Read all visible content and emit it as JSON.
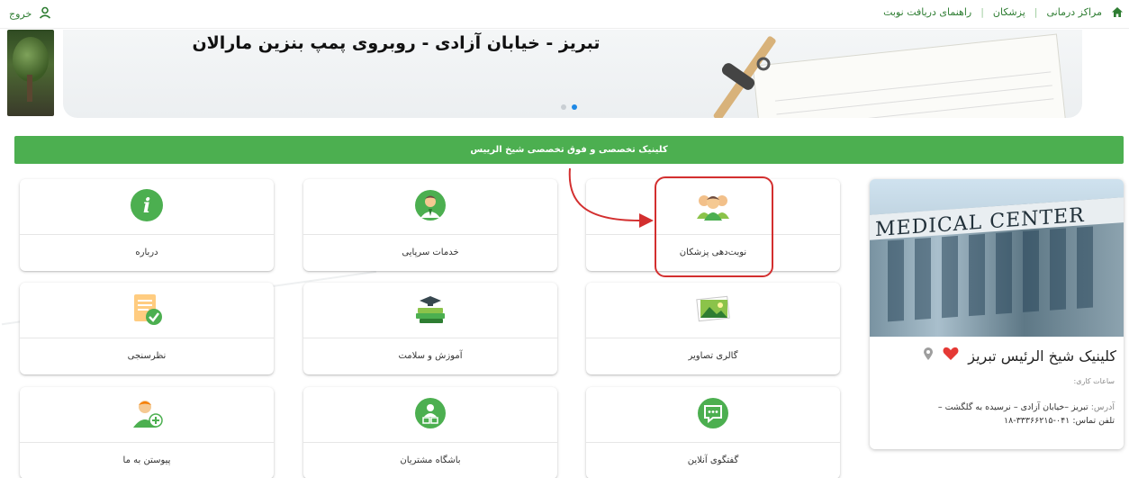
{
  "topbar": {
    "nav": [
      "مراکز درمانی",
      "پزشکان",
      "راهنمای دریافت نوبت"
    ],
    "logout_label": "خروج"
  },
  "banner": {
    "title": "تبریز - خیابان آزادی - روبروی پمپ بنزین مارالان",
    "slides": 2,
    "active_slide": 2
  },
  "section": {
    "title": "کلینیک تخصصی و فوق تخصصی شیخ الرییس"
  },
  "services": [
    {
      "label": "نوبت‌دهی پزشکان",
      "icon": "doctors-group-icon"
    },
    {
      "label": "خدمات سرپایی",
      "icon": "doctor-icon"
    },
    {
      "label": "درباره",
      "icon": "info-icon"
    },
    {
      "label": "گالری تصاویر",
      "icon": "gallery-icon"
    },
    {
      "label": "آموزش و سلامت",
      "icon": "education-books-icon"
    },
    {
      "label": "نظرسنجی",
      "icon": "survey-checklist-icon"
    },
    {
      "label": "گفتگوی آنلاین",
      "icon": "chat-icon"
    },
    {
      "label": "باشگاه مشتریان",
      "icon": "customer-club-icon"
    },
    {
      "label": "پیوستن به ما",
      "icon": "join-us-icon"
    }
  ],
  "clinic": {
    "photo_sign": "MEDICAL CENTER",
    "name": "کلینیک شیخ الرئیس تبریز",
    "hours_label": "ساعات کاری:",
    "address_label": "آدرس:",
    "address": "تبریز –خیابان آزادی – نرسیده به گلگشت –",
    "phone_label": "تلفن تماس:",
    "phone": "۰۴۱-۳۳۳۶۶۲۱۵-۱۸"
  },
  "colors": {
    "primary_green": "#4caf50",
    "nav_green": "#2e7d32",
    "highlight_red": "#d32f2f",
    "heart_red": "#e53935"
  }
}
